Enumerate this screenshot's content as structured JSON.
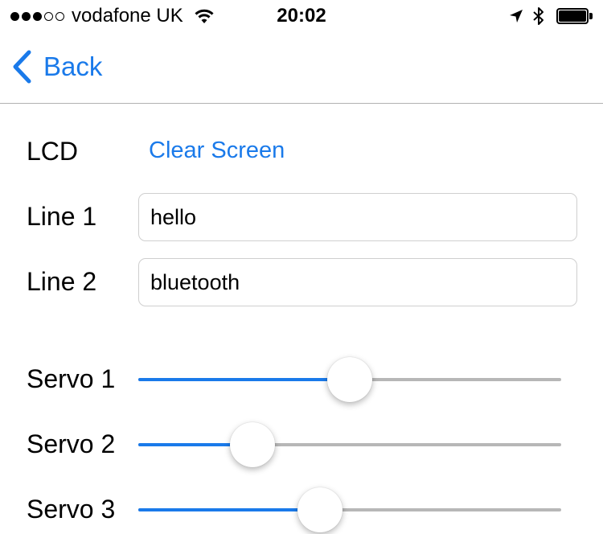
{
  "status_bar": {
    "signal_bars": 5,
    "signal_filled": 3,
    "carrier": "vodafone UK",
    "time": "20:02",
    "icons": [
      "wifi-icon",
      "location-arrow-icon",
      "bluetooth-icon",
      "battery-icon"
    ]
  },
  "nav": {
    "back_label": "Back"
  },
  "lcd": {
    "label": "LCD",
    "clear_label": "Clear Screen",
    "line1_label": "Line 1",
    "line1_value": "hello",
    "line2_label": "Line 2",
    "line2_value": "bluetooth"
  },
  "servos": [
    {
      "label": "Servo 1",
      "value": 0.5
    },
    {
      "label": "Servo 2",
      "value": 0.27
    },
    {
      "label": "Servo 3",
      "value": 0.43
    }
  ],
  "colors": {
    "accent": "#1a7aea",
    "track": "#b7b7b7",
    "field_border": "#cfcfcf"
  }
}
